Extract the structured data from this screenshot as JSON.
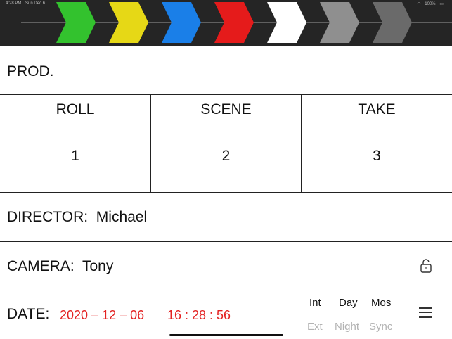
{
  "status": {
    "time": "4:28 PM",
    "date": "Sun Dec 6",
    "battery": "100%"
  },
  "clapper": {
    "stripes": [
      {
        "color": "#33c22e"
      },
      {
        "color": "#e6d816"
      },
      {
        "color": "#1a7fe8"
      },
      {
        "color": "#e51b1b"
      },
      {
        "color": "#ffffff"
      },
      {
        "color": "#8f8f8f"
      },
      {
        "color": "#6a6a6a"
      }
    ]
  },
  "prod": {
    "label": "PROD."
  },
  "grid": {
    "roll": {
      "label": "ROLL",
      "value": "1"
    },
    "scene": {
      "label": "SCENE",
      "value": "2"
    },
    "take": {
      "label": "TAKE",
      "value": "3"
    }
  },
  "director": {
    "text": "DIRECTOR:  Michael"
  },
  "camera": {
    "text": "CAMERA:  Tony"
  },
  "footer": {
    "date_label": "DATE:",
    "date_value": "2020 – 12 – 06",
    "time_value": "16 : 28 : 56",
    "int": "Int",
    "day": "Day",
    "mos": "Mos",
    "ext": "Ext",
    "night": "Night",
    "sync": "Sync"
  }
}
